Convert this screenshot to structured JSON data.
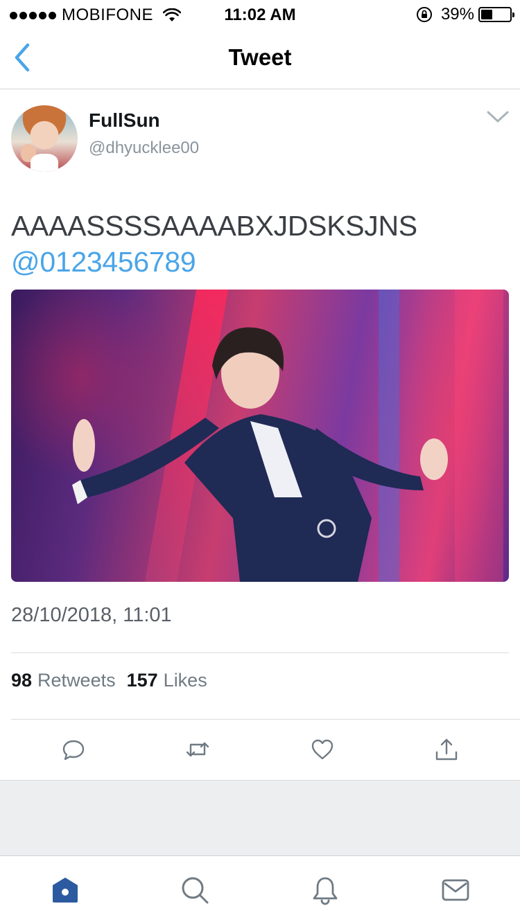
{
  "status_bar": {
    "carrier": "MOBIFONE",
    "time": "11:02 AM",
    "battery_percent_text": "39%",
    "battery_level": 0.39
  },
  "nav": {
    "title": "Tweet",
    "back_icon": "chevron-left-icon"
  },
  "tweet": {
    "display_name": "FullSun",
    "handle": "@dhyucklee00",
    "text": "AAAASSSSAAAABXJDSKSJNS",
    "mention": "@0123456789",
    "timestamp": "28/10/2018, 11:01",
    "retweets_count": "98",
    "retweets_label": "Retweets",
    "likes_count": "157",
    "likes_label": "Likes"
  },
  "actions": [
    {
      "name": "reply",
      "icon": "reply-icon"
    },
    {
      "name": "retweet",
      "icon": "retweet-icon"
    },
    {
      "name": "like",
      "icon": "heart-icon"
    },
    {
      "name": "share",
      "icon": "share-icon"
    }
  ],
  "tab_bar": [
    {
      "name": "home",
      "icon": "home-icon",
      "active": true
    },
    {
      "name": "search",
      "icon": "search-icon",
      "active": false
    },
    {
      "name": "notifications",
      "icon": "bell-icon",
      "active": false
    },
    {
      "name": "messages",
      "icon": "envelope-icon",
      "active": false
    }
  ],
  "colors": {
    "accent": "#4aa5e8",
    "active_tab": "#2c5aa0",
    "text_primary": "#14171a",
    "text_secondary": "#6f7a83"
  }
}
